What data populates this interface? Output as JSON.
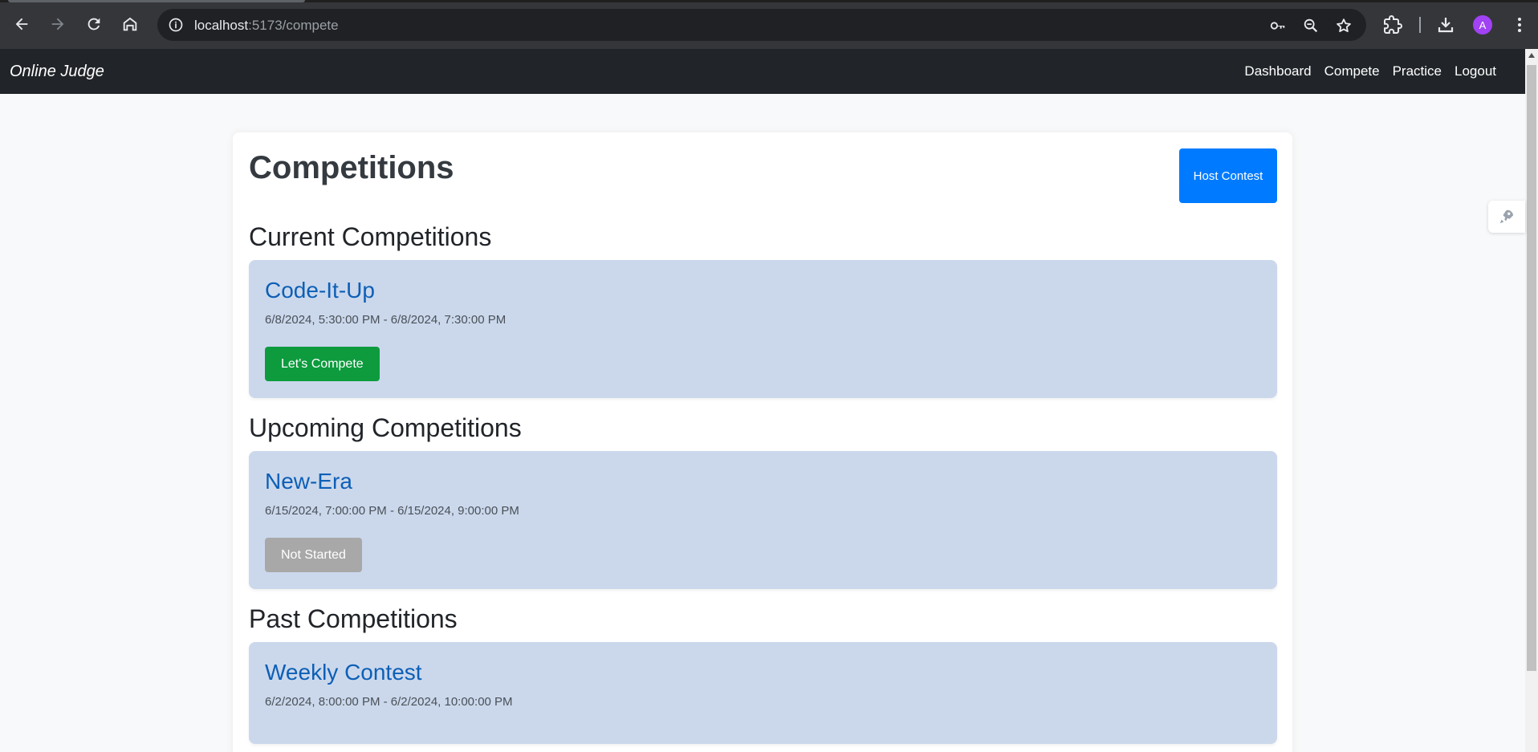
{
  "browser": {
    "url_host": "localhost",
    "url_path": ":5173/compete",
    "avatar_letter": "A"
  },
  "navbar": {
    "brand": "Online Judge",
    "links": [
      "Dashboard",
      "Compete",
      "Practice",
      "Logout"
    ]
  },
  "page": {
    "title": "Competitions",
    "host_button": "Host Contest"
  },
  "sections": [
    {
      "title": "Current Competitions",
      "items": [
        {
          "name": "Code-It-Up",
          "dates": "6/8/2024, 5:30:00 PM - 6/8/2024, 7:30:00 PM",
          "button": "Let's Compete"
        }
      ]
    },
    {
      "title": "Upcoming Competitions",
      "items": [
        {
          "name": "New-Era",
          "dates": "6/15/2024, 7:00:00 PM - 6/15/2024, 9:00:00 PM",
          "button": "Not Started"
        }
      ]
    },
    {
      "title": "Past Competitions",
      "items": [
        {
          "name": "Weekly Contest",
          "dates": "6/2/2024, 8:00:00 PM - 6/2/2024, 10:00:00 PM"
        }
      ]
    }
  ],
  "colors": {
    "navbar": "#212529",
    "primary": "#007bff",
    "success": "#0d9b3e",
    "disabled": "#a8a8a8",
    "card_bg": "#cbd8ec",
    "link": "#0d5fb6"
  }
}
